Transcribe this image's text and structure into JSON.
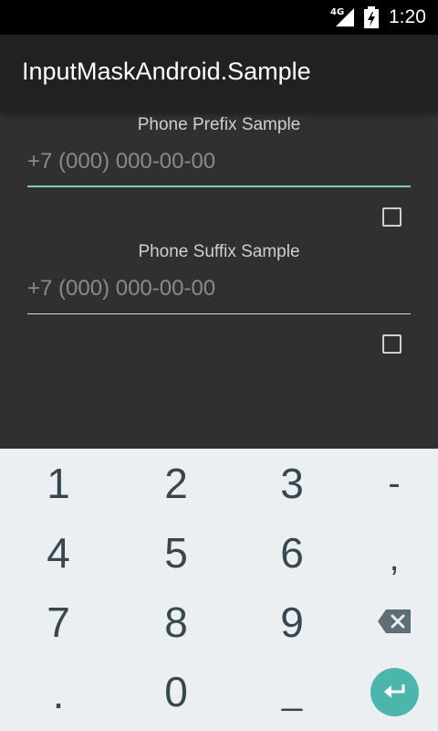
{
  "status_bar": {
    "network": "4G",
    "time": "1:20"
  },
  "app_bar": {
    "title": "InputMaskAndroid.Sample"
  },
  "prefix_section": {
    "label": "Phone Prefix Sample",
    "placeholder": "+7 (000) 000-00-00",
    "checked": false
  },
  "suffix_section": {
    "label": "Phone Suffix Sample",
    "placeholder": "+7 (000) 000-00-00",
    "checked": false
  },
  "keyboard": {
    "row1": [
      "1",
      "2",
      "3",
      "-"
    ],
    "row2": [
      "4",
      "5",
      "6",
      ","
    ],
    "row3": [
      "7",
      "8",
      "9"
    ],
    "row4": [
      ".",
      "0",
      "_"
    ],
    "accent_color": "#4db6ac"
  }
}
